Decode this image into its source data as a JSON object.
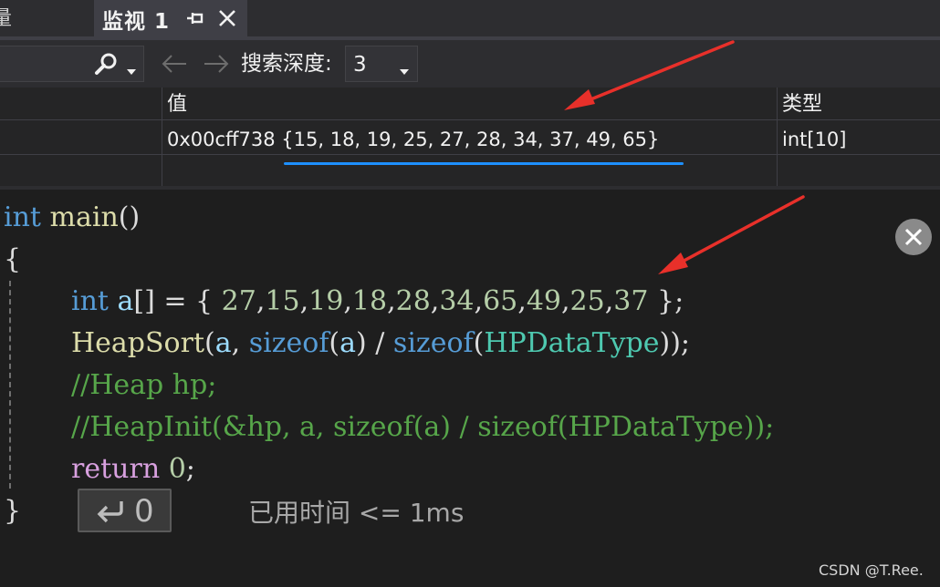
{
  "tabs": {
    "previous_partial_label": "量",
    "active_label": "监视 1"
  },
  "toolbar": {
    "search_icon": "search-icon",
    "depth_label": "搜索深度:",
    "depth_value": "3"
  },
  "watch": {
    "columns": {
      "value": "值",
      "type": "类型"
    },
    "rows": [
      {
        "name": "",
        "value": "0x00cff738 {15, 18, 19, 25, 27, 28, 34, 37, 49, 65}",
        "type": "int[10]"
      }
    ]
  },
  "code": {
    "lines": [
      [
        {
          "t": "int",
          "c": "kw"
        },
        {
          "t": " ",
          "c": "pun"
        },
        {
          "t": "main",
          "c": "fn"
        },
        {
          "t": "()",
          "c": "pun"
        }
      ],
      [
        {
          "t": "{",
          "c": "pun"
        }
      ],
      [
        {
          "t": "int",
          "c": "kw"
        },
        {
          "t": " ",
          "c": "pun"
        },
        {
          "t": "a",
          "c": "var"
        },
        {
          "t": "[] = { ",
          "c": "pun"
        },
        {
          "t": "27",
          "c": "num"
        },
        {
          "t": ",",
          "c": "pun"
        },
        {
          "t": "15",
          "c": "num"
        },
        {
          "t": ",",
          "c": "pun"
        },
        {
          "t": "19",
          "c": "num"
        },
        {
          "t": ",",
          "c": "pun"
        },
        {
          "t": "18",
          "c": "num"
        },
        {
          "t": ",",
          "c": "pun"
        },
        {
          "t": "28",
          "c": "num"
        },
        {
          "t": ",",
          "c": "pun"
        },
        {
          "t": "34",
          "c": "num"
        },
        {
          "t": ",",
          "c": "pun"
        },
        {
          "t": "65",
          "c": "num"
        },
        {
          "t": ",",
          "c": "pun"
        },
        {
          "t": "49",
          "c": "num"
        },
        {
          "t": ",",
          "c": "pun"
        },
        {
          "t": "25",
          "c": "num"
        },
        {
          "t": ",",
          "c": "pun"
        },
        {
          "t": "37",
          "c": "num"
        },
        {
          "t": " };",
          "c": "pun"
        }
      ],
      [
        {
          "t": "HeapSort",
          "c": "fn"
        },
        {
          "t": "(",
          "c": "pun"
        },
        {
          "t": "a",
          "c": "var"
        },
        {
          "t": ", ",
          "c": "pun"
        },
        {
          "t": "sizeof",
          "c": "kw"
        },
        {
          "t": "(",
          "c": "pun"
        },
        {
          "t": "a",
          "c": "var"
        },
        {
          "t": ") / ",
          "c": "pun"
        },
        {
          "t": "sizeof",
          "c": "kw"
        },
        {
          "t": "(",
          "c": "pun"
        },
        {
          "t": "HPDataType",
          "c": "typ"
        },
        {
          "t": "));",
          "c": "pun"
        }
      ],
      [
        {
          "t": "//Heap hp;",
          "c": "cmt"
        }
      ],
      [
        {
          "t": "//HeapInit(&hp, a, sizeof(a) / sizeof(HPDataType));",
          "c": "cmt"
        }
      ],
      [
        {
          "t": "return",
          "c": "ret"
        },
        {
          "t": " ",
          "c": "pun"
        },
        {
          "t": "0",
          "c": "num"
        },
        {
          "t": ";",
          "c": "pun"
        }
      ],
      [
        {
          "t": "}",
          "c": "pun"
        }
      ]
    ],
    "return_value": "0",
    "elapsed_text": "已用时间 <= 1ms"
  },
  "watermark": "CSDN @T.Ree.",
  "colors": {
    "keyword": "#569cd6",
    "function": "#dcdcaa",
    "variable": "#9cdcfe",
    "number": "#b5cea8",
    "type": "#4ec9b0",
    "comment": "#57a64a",
    "control": "#d8a0df",
    "annotation_arrow": "#e8302a",
    "highlight_underline": "#1e90ff"
  }
}
